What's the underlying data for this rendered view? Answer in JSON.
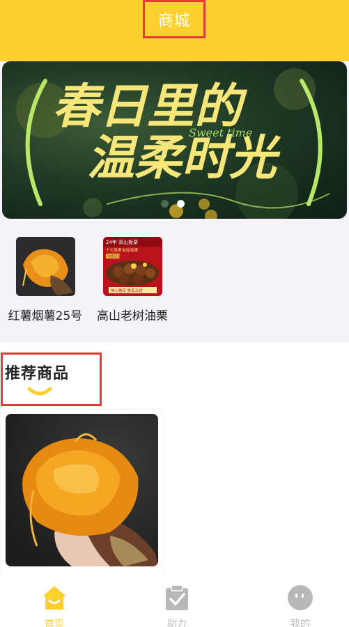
{
  "header": {
    "title": "商城"
  },
  "banner": {
    "headline_line1": "春日里的",
    "headline_line2": "温柔时光",
    "script_text": "Sweet   time",
    "slide_count": 2,
    "active_slide": 2
  },
  "categories": [
    {
      "label": "红薯烟薯25号",
      "icon": "sweet-potato-thumbnail"
    },
    {
      "label": "高山老树油栗",
      "icon": "chestnut-thumbnail"
    }
  ],
  "chestnut_poster": {
    "top_text": "24年 高山板栗",
    "sub_text": "个大饱满 粒粒饱满",
    "tag_text": "现摘现发",
    "bottom_text": "放心购买 售后无忧"
  },
  "recommend": {
    "title": "推荐商品",
    "products": [
      {
        "image": "baked-sweet-potato-photo"
      }
    ]
  },
  "tabbar": {
    "active_color": "#fcd02e",
    "inactive_color": "#b8b8b8",
    "tabs": [
      {
        "label": "首页",
        "icon": "home-icon",
        "active": true
      },
      {
        "label": "助力",
        "icon": "clipboard-check-icon",
        "active": false
      },
      {
        "label": "我的",
        "icon": "profile-face-icon",
        "active": false
      }
    ]
  },
  "colors": {
    "accent": "#fcd02e",
    "highlight_border": "#e23a36"
  }
}
